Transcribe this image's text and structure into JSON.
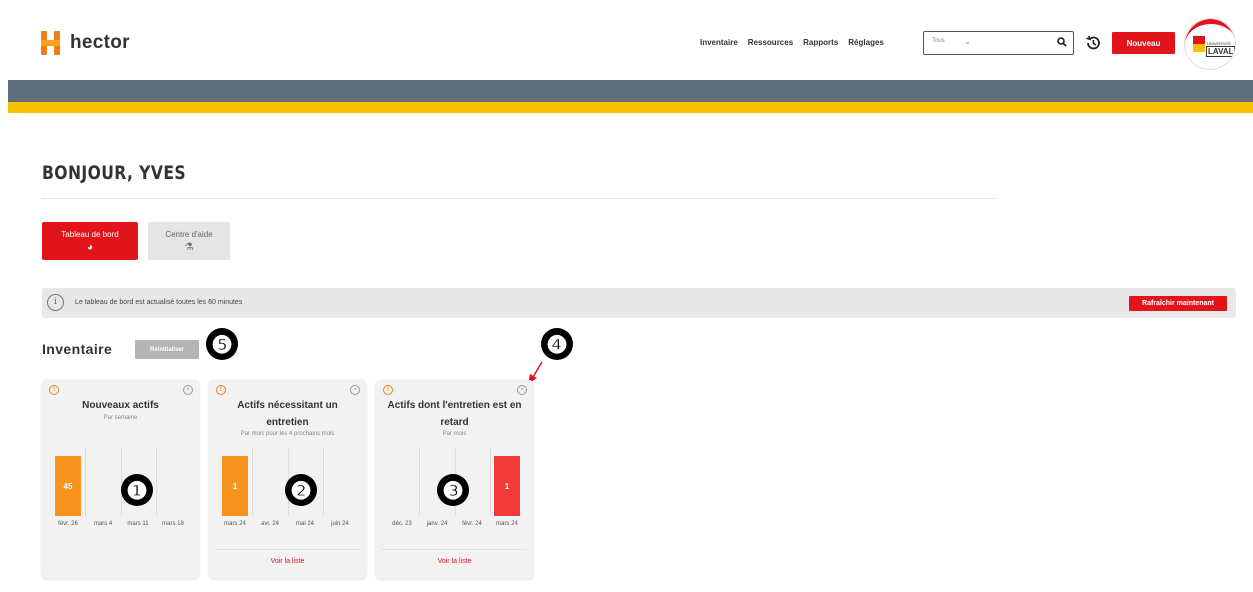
{
  "app": {
    "brand": "hector",
    "nav": [
      "Inventaire",
      "Ressources",
      "Rapports",
      "Réglages"
    ],
    "search": {
      "selected": "Tous"
    },
    "new_button": "Nouveau",
    "avatar": {
      "university_small": "UNIVERSITÉ",
      "university_name": "LAVAL"
    }
  },
  "colors": {
    "brand_red": "#e1141c",
    "brand_orange": "#f07c1a",
    "band_grey": "#5f6f7d",
    "band_yellow": "#f8c200",
    "bar_orange": "#f7941d",
    "bar_red": "#f23a3a"
  },
  "page": {
    "greeting": "BONJOUR, YVES",
    "tabs": [
      {
        "label": "Tableau de bord",
        "icon": "gauge-icon",
        "active": true
      },
      {
        "label": "Centre d'aide",
        "icon": "help-desk-icon",
        "active": false
      }
    ],
    "info": {
      "icon": "info-icon",
      "text": "Le tableau de bord est actualisé toutes les 60 minutes",
      "refresh_label": "Rafraîchir maintenant"
    }
  },
  "inventory": {
    "title": "Inventaire",
    "reset_label": "Réinitialiser",
    "markers": [
      "❺",
      "❹",
      "❶",
      "❷",
      "❸"
    ],
    "cards": [
      {
        "title": "Nouveaux actifs",
        "subtitle": "Par semaine",
        "link": "",
        "chart_data": {
          "type": "bar",
          "categories": [
            "févr. 26",
            "mars 4",
            "mars 11",
            "mars 18"
          ],
          "values": [
            45,
            0,
            0,
            0
          ],
          "data_labels": [
            "45",
            "",
            "",
            ""
          ],
          "bar_color": "#f7941d"
        }
      },
      {
        "title": "Actifs nécessitant un entretien",
        "subtitle": "Par mois pour les 4 prochains mois",
        "link": "Voir la liste",
        "chart_data": {
          "type": "bar",
          "categories": [
            "mars 24",
            "avr. 24",
            "mai 24",
            "juin 24"
          ],
          "values": [
            1,
            0,
            0,
            0
          ],
          "data_labels": [
            "1",
            "",
            "",
            ""
          ],
          "bar_color": "#f7941d"
        }
      },
      {
        "title": "Actifs dont l'entretien est en retard",
        "subtitle": "Par mois",
        "link": "Voir la liste",
        "chart_data": {
          "type": "bar",
          "categories": [
            "déc. 23",
            "janv. 24",
            "févr. 24",
            "mars 24"
          ],
          "values": [
            0,
            0,
            0,
            1
          ],
          "data_labels": [
            "",
            "",
            "",
            "1"
          ],
          "bar_color": "#f23a3a"
        }
      }
    ]
  }
}
